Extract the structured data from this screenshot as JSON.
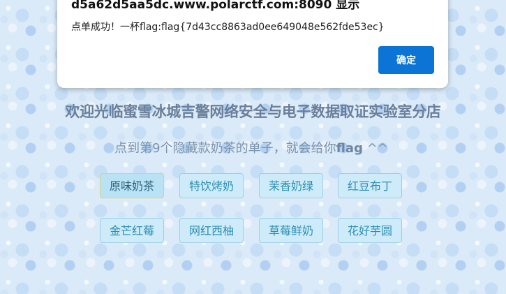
{
  "dialog": {
    "title": "d5a62d5aa5dc.www.polarctf.com:8090 显示",
    "message": "点单成功！一杯flag:flag{7d43cc8863ad0ee649048e562fde53ec}",
    "ok_label": "确定"
  },
  "page": {
    "heading": "欢迎光临蜜雪冰城吉警网络安全与电子数据取证实验室分店",
    "subtitle_prefix": "点到第9个隐藏款奶茶的单子，就会给你",
    "subtitle_strong": "flag",
    "subtitle_suffix": " ^^"
  },
  "menu": {
    "items": [
      {
        "label": "原味奶茶"
      },
      {
        "label": "特饮烤奶"
      },
      {
        "label": "茉香奶绿"
      },
      {
        "label": "红豆布丁"
      },
      {
        "label": "金芒红莓"
      },
      {
        "label": "网红西柚"
      },
      {
        "label": "草莓鲜奶"
      },
      {
        "label": "花好芋圆"
      }
    ]
  },
  "colors": {
    "accent": "#0b74d5",
    "button_bg": "#cdebf8",
    "button_text": "#2e8fb3"
  }
}
